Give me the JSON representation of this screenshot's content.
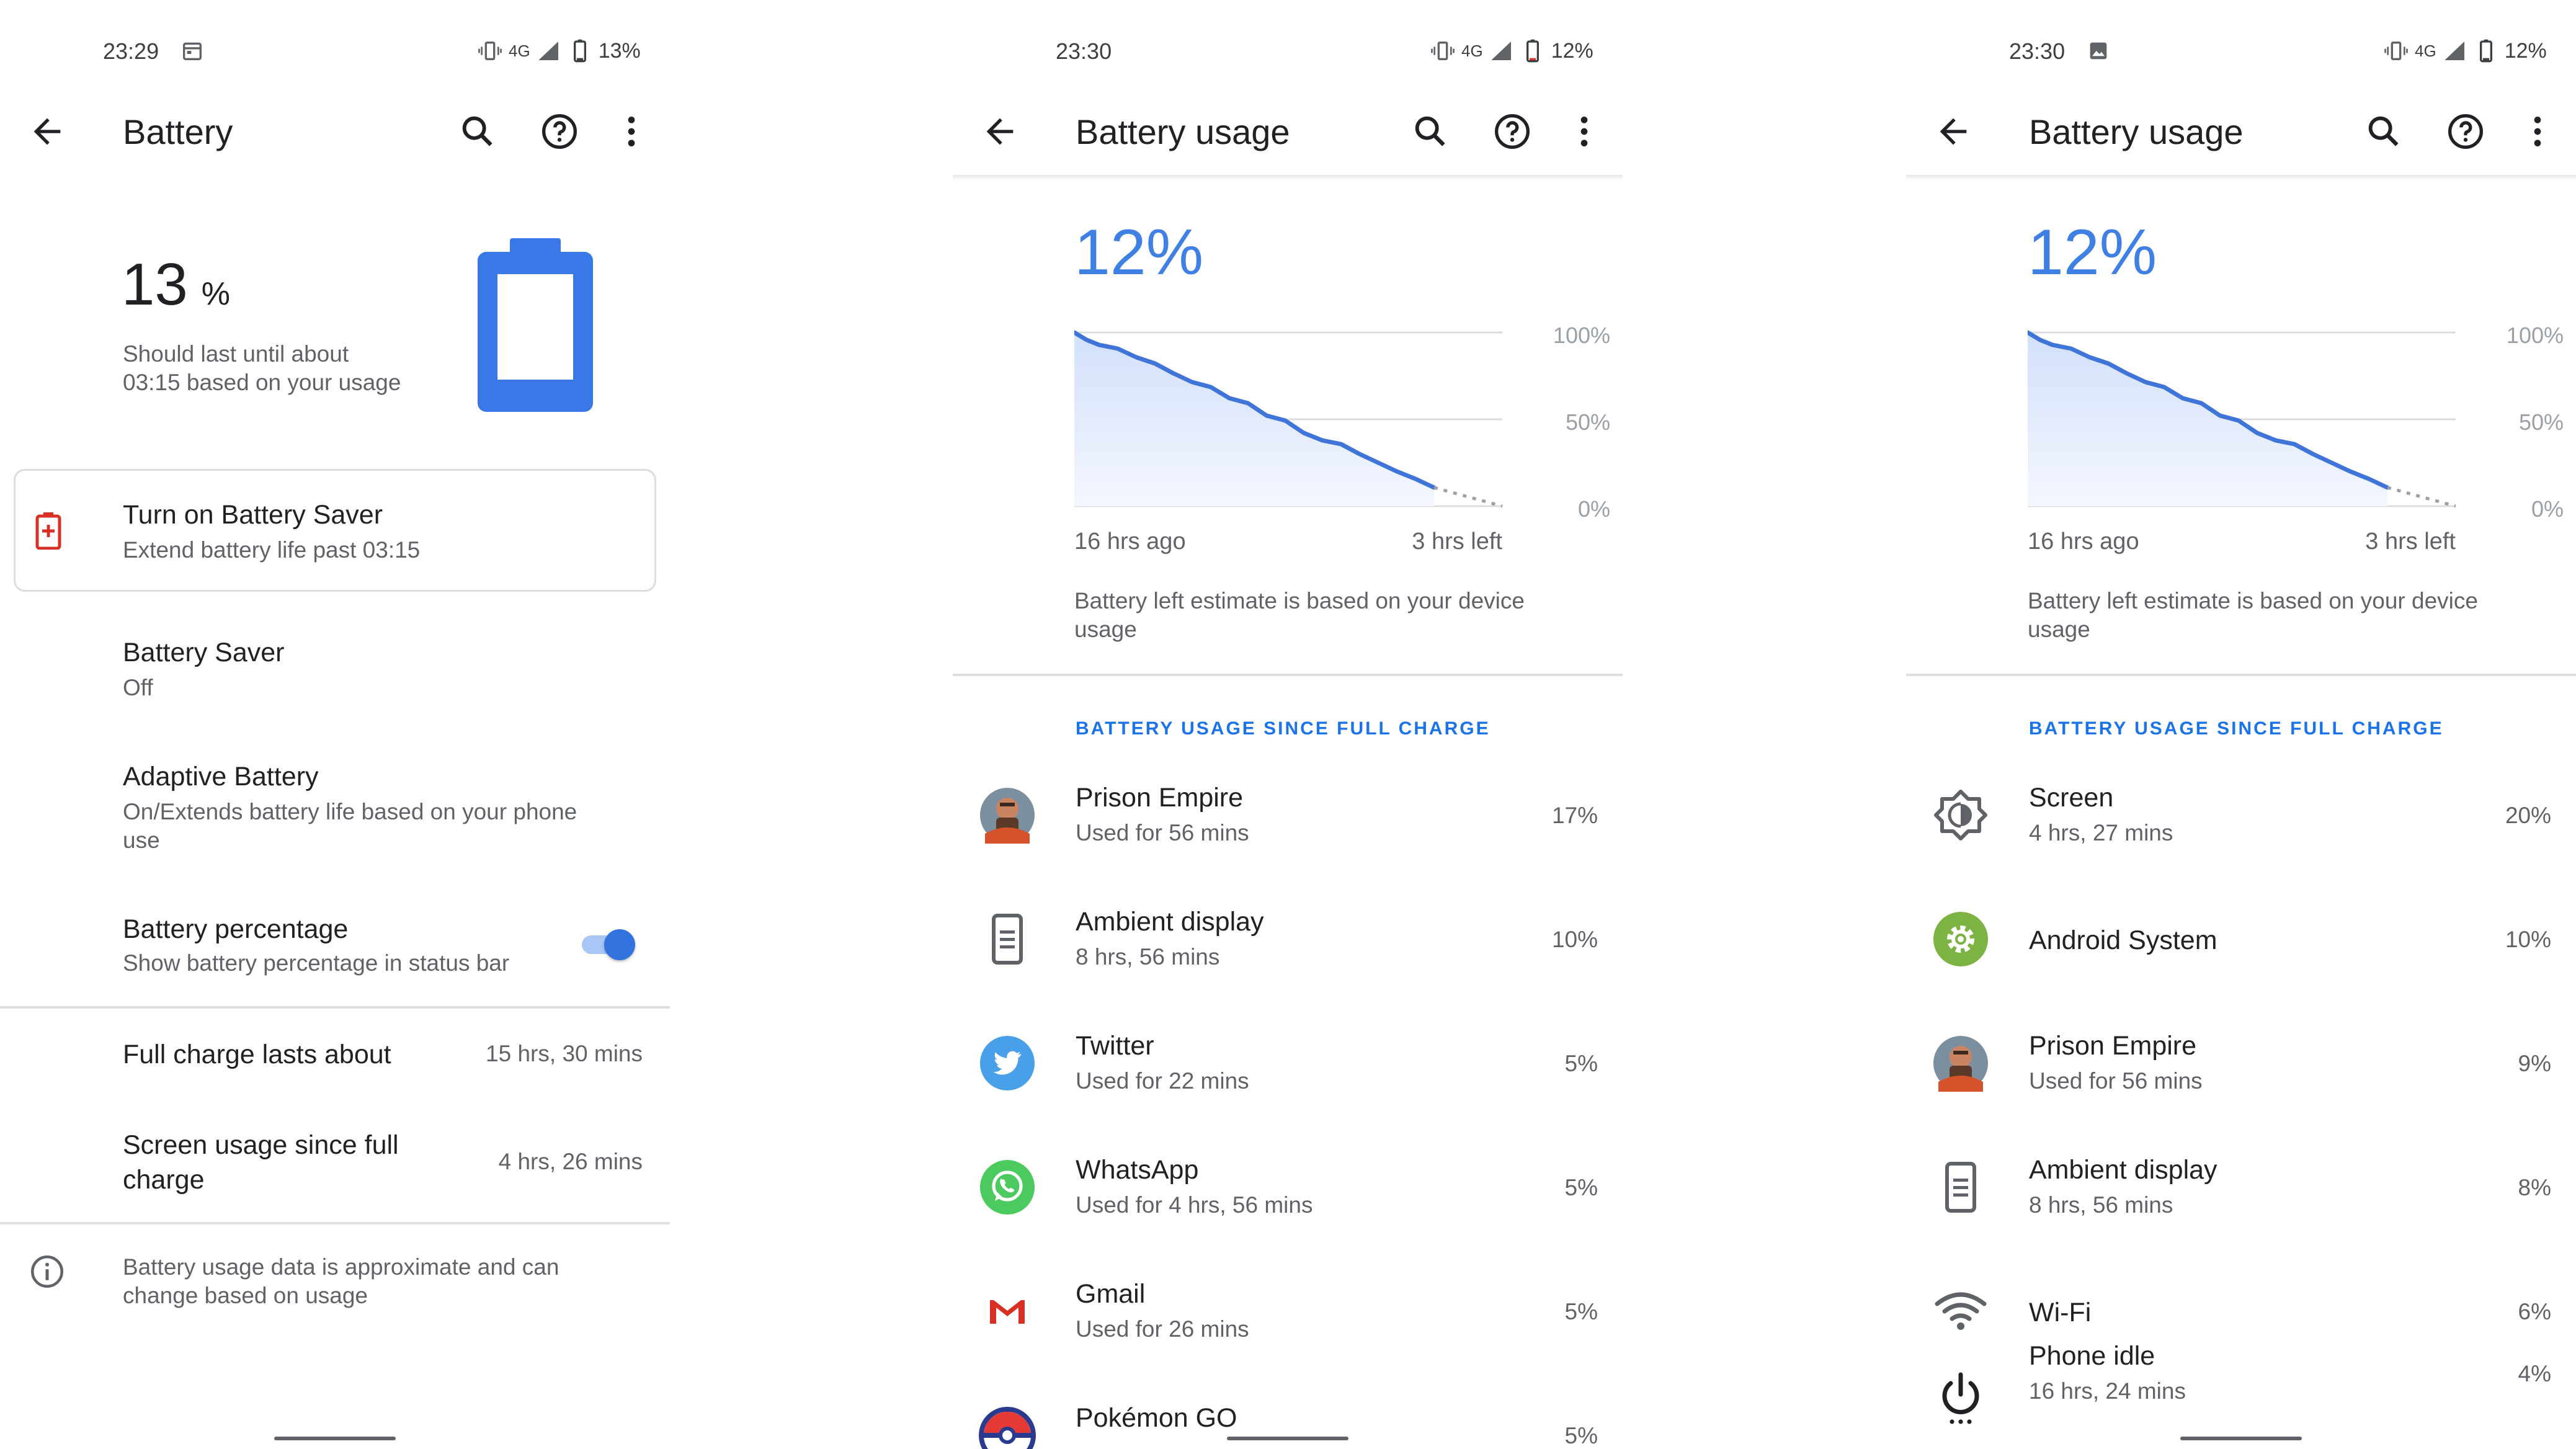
{
  "screen1": {
    "status": {
      "time": "23:29",
      "network": "4G",
      "battery_text": "13%"
    },
    "title": "Battery",
    "battery_level": {
      "number": "13",
      "unit": "%",
      "fraction": 0.13
    },
    "estimate_line1": "Should last until about",
    "estimate_line2": "03:15 based on your usage",
    "saver_card": {
      "title": "Turn on Battery Saver",
      "subtitle": "Extend battery life past 03:15"
    },
    "battery_saver": {
      "title": "Battery Saver",
      "subtitle": "Off"
    },
    "adaptive": {
      "title": "Adaptive Battery",
      "subtitle_line1": "On/Extends battery life based on your phone",
      "subtitle_line2": "use"
    },
    "percentage": {
      "title": "Battery percentage",
      "subtitle": "Show battery percentage in status bar",
      "enabled": true
    },
    "full_charge": {
      "label": "Full charge lasts about",
      "value": "15 hrs, 30 mins"
    },
    "screen_usage": {
      "label_line1": "Screen usage since full",
      "label_line2": "charge",
      "value": "4 hrs, 26 mins"
    },
    "footer_line1": "Battery usage data is approximate and can",
    "footer_line2": "change based on usage"
  },
  "screen2": {
    "status": {
      "time": "23:30",
      "network": "4G",
      "battery_text": "12%"
    },
    "title": "Battery usage",
    "level": "12%",
    "y_ticks": [
      "100%",
      "50%",
      "0%"
    ],
    "x_start": "16 hrs ago",
    "x_end": "3 hrs left",
    "estimate_line1": "Battery left estimate is based on your device",
    "estimate_line2": "usage",
    "section": "BATTERY USAGE SINCE FULL CHARGE",
    "apps": [
      {
        "name": "Prison Empire",
        "detail": "Used for 56 mins",
        "pct": "17%",
        "icon": "prison-empire-icon"
      },
      {
        "name": "Ambient display",
        "detail": "8 hrs, 56 mins",
        "pct": "10%",
        "icon": "ambient-display-icon"
      },
      {
        "name": "Twitter",
        "detail": "Used for 22 mins",
        "pct": "5%",
        "icon": "twitter-icon"
      },
      {
        "name": "WhatsApp",
        "detail": "Used for 4 hrs, 56 mins",
        "pct": "5%",
        "icon": "whatsapp-icon"
      },
      {
        "name": "Gmail",
        "detail": "Used for 26 mins",
        "pct": "5%",
        "icon": "gmail-icon"
      },
      {
        "name": "Pokémon GO",
        "detail": "",
        "pct": "5%",
        "icon": "pokemon-go-icon"
      }
    ]
  },
  "screen3": {
    "status": {
      "time": "23:30",
      "network": "4G",
      "battery_text": "12%"
    },
    "title": "Battery usage",
    "level": "12%",
    "y_ticks": [
      "100%",
      "50%",
      "0%"
    ],
    "x_start": "16 hrs ago",
    "x_end": "3 hrs left",
    "estimate_line1": "Battery left estimate is based on your device",
    "estimate_line2": "usage",
    "section": "BATTERY USAGE SINCE FULL CHARGE",
    "apps": [
      {
        "name": "Screen",
        "detail": "4 hrs, 27 mins",
        "pct": "20%",
        "icon": "brightness-icon"
      },
      {
        "name": "Android System",
        "detail": "",
        "pct": "10%",
        "icon": "android-system-icon"
      },
      {
        "name": "Prison Empire",
        "detail": "Used for 56 mins",
        "pct": "9%",
        "icon": "prison-empire-icon"
      },
      {
        "name": "Ambient display",
        "detail": "8 hrs, 56 mins",
        "pct": "8%",
        "icon": "ambient-display-icon"
      },
      {
        "name": "Wi-Fi",
        "detail": "",
        "pct": "6%",
        "icon": "wifi-icon"
      },
      {
        "name": "Phone idle",
        "detail": "16 hrs, 24 mins",
        "pct": "4%",
        "icon": "power-icon"
      }
    ]
  },
  "colors": {
    "accent": "#1a73e8",
    "chart_line": "#3f74d8",
    "battery_fill": "#3b78e7",
    "saver_red": "#d93025"
  }
}
